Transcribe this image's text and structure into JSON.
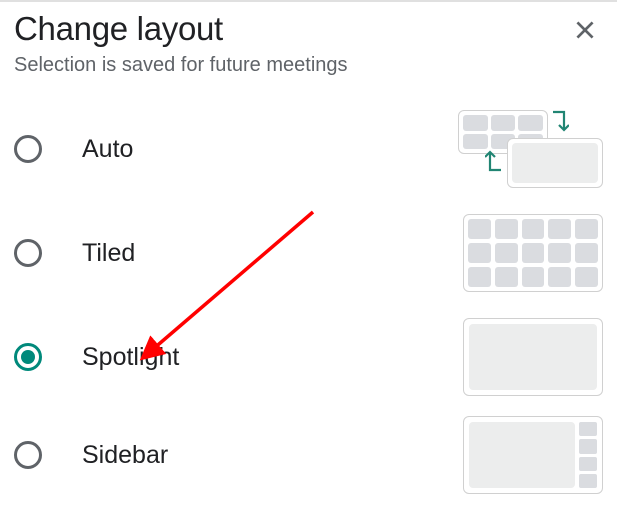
{
  "dialog": {
    "title": "Change layout",
    "subtitle": "Selection is saved for future meetings"
  },
  "options": [
    {
      "id": "auto",
      "label": "Auto",
      "selected": false
    },
    {
      "id": "tiled",
      "label": "Tiled",
      "selected": false
    },
    {
      "id": "spotlight",
      "label": "Spotlight",
      "selected": true
    },
    {
      "id": "sidebar",
      "label": "Sidebar",
      "selected": false
    }
  ],
  "annotation": {
    "type": "arrow",
    "color": "#ff0000",
    "points_to": "spotlight"
  }
}
